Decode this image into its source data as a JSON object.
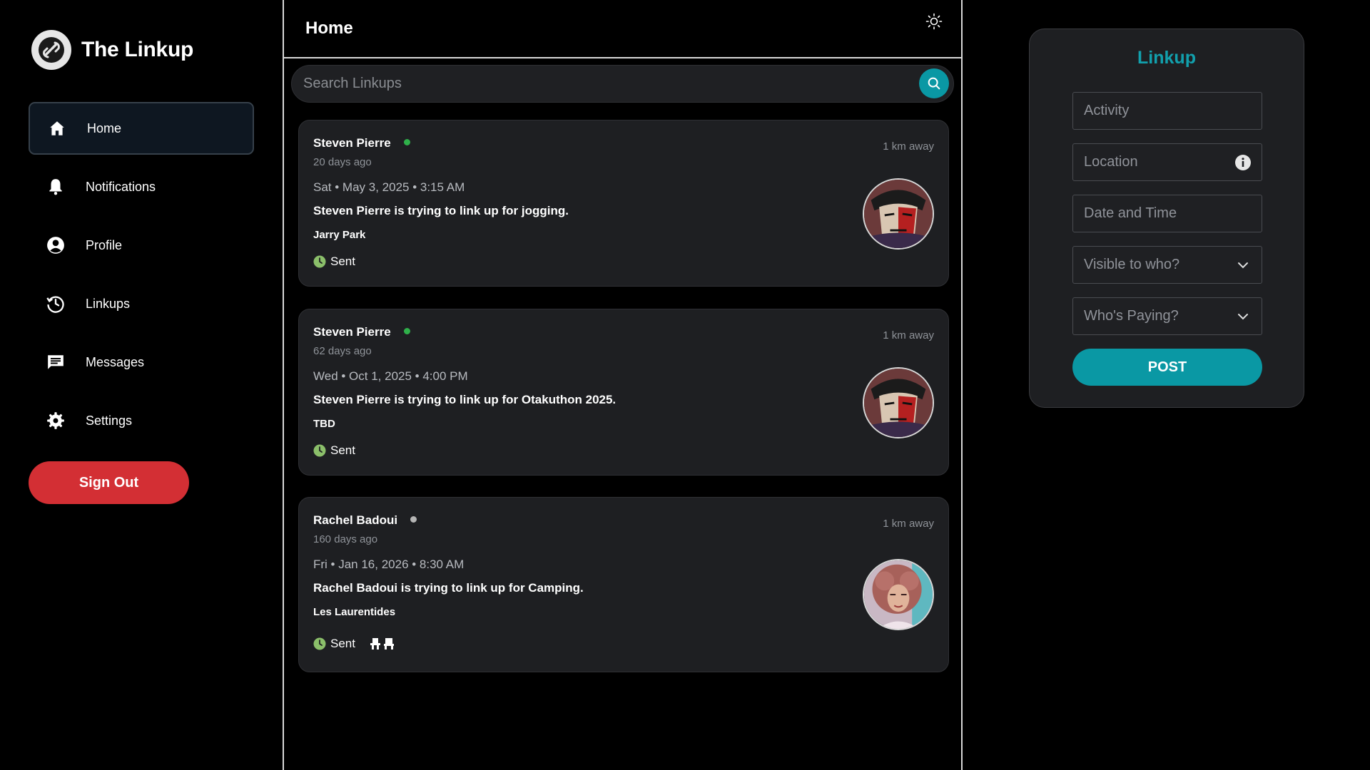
{
  "app": {
    "name": "The Linkup"
  },
  "sidebar": {
    "items": [
      {
        "label": "Home",
        "icon": "home-icon",
        "active": true
      },
      {
        "label": "Notifications",
        "icon": "bell-icon",
        "active": false
      },
      {
        "label": "Profile",
        "icon": "user-circle-icon",
        "active": false
      },
      {
        "label": "Linkups",
        "icon": "history-icon",
        "active": false
      },
      {
        "label": "Messages",
        "icon": "message-icon",
        "active": false
      },
      {
        "label": "Settings",
        "icon": "gear-icon",
        "active": false
      }
    ],
    "signout_label": "Sign Out"
  },
  "feed": {
    "title": "Home",
    "search_placeholder": "Search Linkups",
    "posts": [
      {
        "name": "Steven Pierre",
        "online": true,
        "ago": "20 days ago",
        "distance": "1 km away",
        "date": "Sat • May 3, 2025 • 3:15 AM",
        "description": "Steven Pierre is trying to link up for jogging.",
        "location": "Jarry Park",
        "status": "Sent"
      },
      {
        "name": "Steven Pierre",
        "online": true,
        "ago": "62 days ago",
        "distance": "1 km away",
        "date": "Wed • Oct 1, 2025 • 4:00 PM",
        "description": "Steven Pierre is trying to link up for Otakuthon 2025.",
        "location": "TBD",
        "status": "Sent"
      },
      {
        "name": "Rachel Badoui",
        "online": false,
        "ago": "160 days ago",
        "distance": "1 km away",
        "date": "Fri • Jan 16, 2026 • 8:30 AM",
        "description": "Rachel Badoui is trying to link up for Camping.",
        "location": "Les Laurentides",
        "status": "Sent"
      }
    ]
  },
  "panel": {
    "title": "Linkup",
    "activity_placeholder": "Activity",
    "location_placeholder": "Location",
    "datetime_placeholder": "Date and Time",
    "visibility_placeholder": "Visible to who?",
    "paying_placeholder": "Who's Paying?",
    "post_label": "POST"
  },
  "colors": {
    "accent": "#0a98a4",
    "danger": "#d32f34",
    "online": "#2fb04a",
    "offline": "#b5b5b5",
    "status": "#8bbf6a"
  }
}
